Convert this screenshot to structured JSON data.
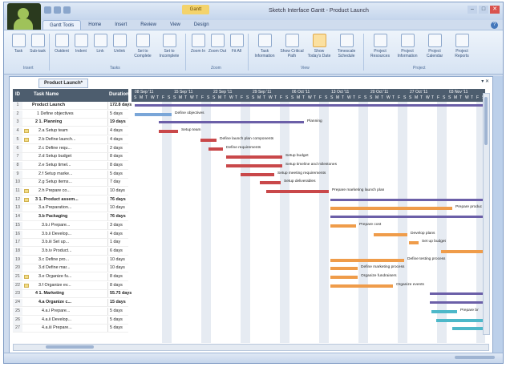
{
  "app": {
    "window_title": "Sketch Interface Gantt - Product Launch",
    "context_tab": "Gantt"
  },
  "tabs": [
    "Gantt Tools",
    "Home",
    "Insert",
    "Review",
    "View",
    "Design"
  ],
  "ribbon": {
    "buttons": [
      "Task",
      "Sub-task",
      "Outdent",
      "Indent",
      "Link",
      "Unlink",
      "Set to Complete",
      "Set to Incomplete",
      "Zoom In",
      "Zoom Out",
      "Fit All",
      "Task Information",
      "Show Critical Path",
      "Show Today's Date",
      "Timescale Schedule",
      "Project Resources",
      "Project Information",
      "Project Calendar",
      "Project Reports"
    ],
    "groups": [
      "Insert",
      "Tasks",
      "Zoom",
      "View",
      "Project"
    ]
  },
  "document": {
    "tab_label": "Product Launch*",
    "controls": "▾ ✕"
  },
  "grid": {
    "headers": {
      "id": "ID",
      "name": "Task Name",
      "duration": "Duration"
    },
    "rows": [
      {
        "id": "1",
        "name": "Product Launch",
        "dur": "172.8 days",
        "sum": true
      },
      {
        "id": "2",
        "name": "1 Define objectives",
        "dur": "5 days"
      },
      {
        "id": "3",
        "name": "2 1. Planning",
        "dur": "19 days",
        "sum": true
      },
      {
        "id": "4",
        "name": "2.a Setup team",
        "dur": "4 days"
      },
      {
        "id": "5",
        "name": "2.b Define launch...",
        "dur": "4 days"
      },
      {
        "id": "6",
        "name": "2.c Define requ...",
        "dur": "2 days"
      },
      {
        "id": "7",
        "name": "2.d Setup budget",
        "dur": "8 days"
      },
      {
        "id": "8",
        "name": "2.e Setup timel...",
        "dur": "8 days"
      },
      {
        "id": "9",
        "name": "2.f Setup marke...",
        "dur": "5 days"
      },
      {
        "id": "10",
        "name": "2.g Setup items...",
        "dur": "7 day"
      },
      {
        "id": "11",
        "name": "2.h Prepare co...",
        "dur": "10 days"
      },
      {
        "id": "12",
        "name": "3 1. Product assem...",
        "dur": "76 days",
        "sum": true
      },
      {
        "id": "13",
        "name": "3.a Preparation...",
        "dur": "10 days"
      },
      {
        "id": "14",
        "name": "3.b Packaging",
        "dur": "76 days",
        "sum": true
      },
      {
        "id": "15",
        "name": "3.b.i Prepare...",
        "dur": "3 days"
      },
      {
        "id": "16",
        "name": "3.b.ii Develop...",
        "dur": "4 days"
      },
      {
        "id": "17",
        "name": "3.b.iii Set up...",
        "dur": "1 day"
      },
      {
        "id": "18",
        "name": "3.b.iv Product...",
        "dur": "6 days"
      },
      {
        "id": "19",
        "name": "3.c Define pro...",
        "dur": "10 days"
      },
      {
        "id": "20",
        "name": "3.d Define mar...",
        "dur": "10 days"
      },
      {
        "id": "21",
        "name": "3.e Organize fu...",
        "dur": "8 days"
      },
      {
        "id": "22",
        "name": "3.f Organize ev...",
        "dur": "8 days"
      },
      {
        "id": "23",
        "name": "4 1. Marketing",
        "dur": "55.75 days",
        "sum": true
      },
      {
        "id": "24",
        "name": "4.a Organize c...",
        "dur": "15 days",
        "sum": true
      },
      {
        "id": "25",
        "name": "4.a.i Prepare...",
        "dur": "5 days"
      },
      {
        "id": "26",
        "name": "4.a.ii Develop...",
        "dur": "5 days"
      },
      {
        "id": "27",
        "name": "4.a.iii Prepare...",
        "dur": "5 days"
      }
    ]
  },
  "gantt": {
    "weeks": [
      "08 Sep '11",
      "15 Sep '11",
      "22 Sep '11",
      "29 Sep '11",
      "06 Oct '11",
      "13 Oct '11",
      "20 Oct '11",
      "27 Oct '11",
      "03 Nov '11"
    ],
    "labels": {
      "l2": "Define objectives",
      "l3": "Planning",
      "l4": "Setup team",
      "l5": "Define launch plan components",
      "l6": "Define requirements",
      "l7": "Setup budget",
      "l8": "Setup timeline and milestones",
      "l9": "Setup meeting requirements",
      "l10": "Setup deliverables",
      "l11": "Prepare marketing launch plan",
      "l13": "Prepare produc",
      "l15": "Prepare cost",
      "l16": "Develop plans",
      "l17": "Set up budget",
      "l19": "Define testing process",
      "l20": "Define marketing process",
      "l21": "Organize fundraisers",
      "l22": "Organize events",
      "l25": "Prepare br"
    },
    "colors": {
      "planning": "#c9484a",
      "assembly": "#ef9c4a",
      "summary": "#6b5fa8",
      "marketing": "#4db8c9"
    }
  }
}
